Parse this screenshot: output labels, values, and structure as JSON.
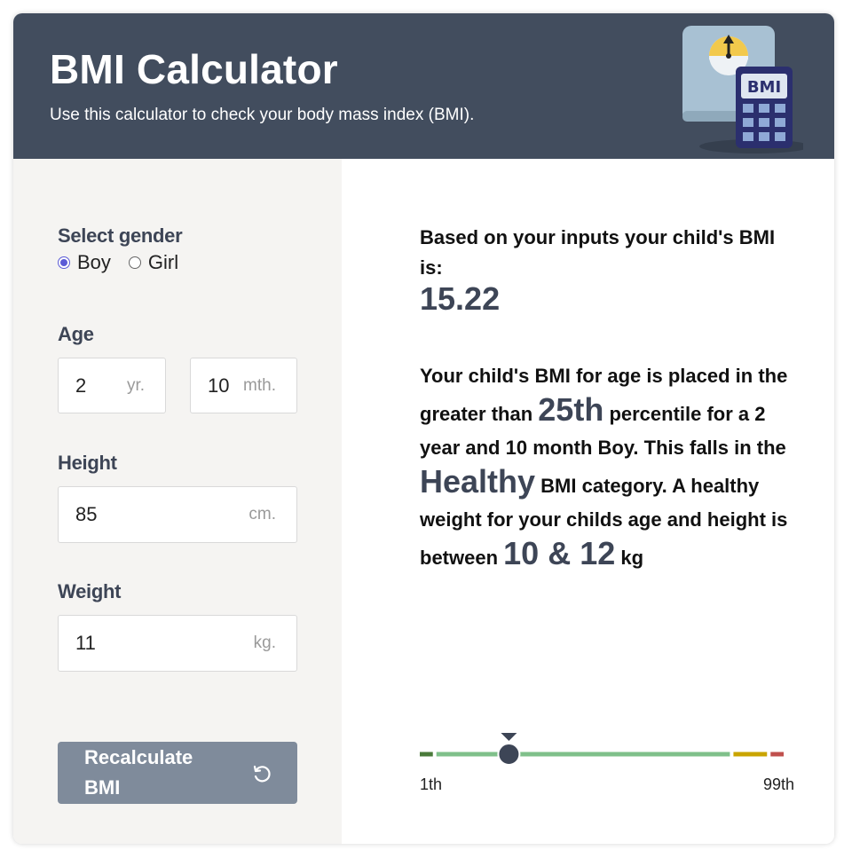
{
  "header": {
    "title": "BMI Calculator",
    "subtitle": "Use this calculator to check your body mass index (BMI).",
    "illustration_label": "BMI"
  },
  "form": {
    "gender_label": "Select gender",
    "gender_options": [
      "Boy",
      "Girl"
    ],
    "gender_selected": "Boy",
    "age_label": "Age",
    "age_years": "2",
    "age_years_unit": "yr.",
    "age_months": "10",
    "age_months_unit": "mth.",
    "height_label": "Height",
    "height_value": "85",
    "height_unit": "cm.",
    "weight_label": "Weight",
    "weight_value": "11",
    "weight_unit": "kg.",
    "recalculate_label": "Recalculate BMI"
  },
  "result": {
    "intro": "Based on your inputs your child's BMI is:",
    "bmi": "15.22",
    "p1": "Your child's BMI for age is placed in the greater than",
    "percentile": "25th",
    "p2": "percentile for a 2 year and 10 month Boy. This falls in the",
    "category": "Healthy",
    "p3": "BMI category. A healthy weight for your childs age and height is between",
    "range": "10 & 12",
    "p4": "kg"
  },
  "scale": {
    "min_label": "1th",
    "max_label": "99th",
    "marker_percentile": 25,
    "colors": {
      "underweight": "#4a7a3a",
      "healthy": "#7fc08a",
      "overweight": "#c9a400",
      "obese": "#c0504d",
      "marker": "#3d4556"
    }
  }
}
